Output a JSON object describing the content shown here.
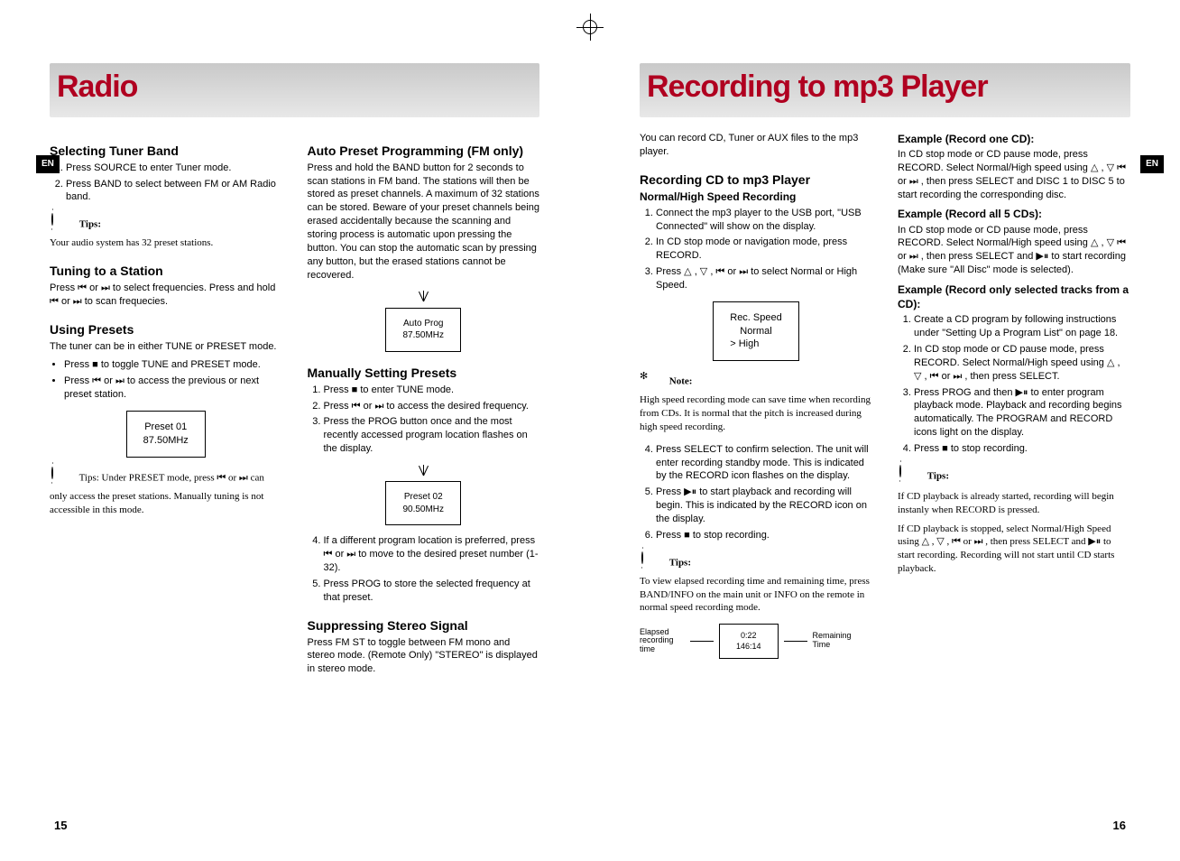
{
  "lang_badge": "EN",
  "left": {
    "chapter": "Radio",
    "page_num": "15",
    "sec_sel_band": "Selecting Tuner Band",
    "sel_band_1": "Press SOURCE to enter Tuner mode.",
    "sel_band_2": "Press BAND to select between FM or AM Radio band.",
    "tips_label": "Tips:",
    "tips_32": "Your audio system has 32 preset stations.",
    "sec_tuning": "Tuning to a Station",
    "tuning_p": "Press ⏮ or ⏭ to select frequencies. Press and hold ⏮ or ⏭ to scan frequecies.",
    "sec_presets": "Using Presets",
    "presets_intro": "The tuner can be in either TUNE or PRESET mode.",
    "presets_b1": "Press ■ to toggle TUNE and PRESET mode.",
    "presets_b2": "Press ⏮ or ⏭ to access the previous or next preset station.",
    "disp_preset01_a": "Preset 01",
    "disp_preset01_b": "87.50MHz",
    "tips_preset": "Tips: Under PRESET mode, press ⏮ or ⏭ can only access the preset stations. Manually tuning is not accessible in this mode.",
    "sec_auto": "Auto Preset Programming (FM only)",
    "auto_p": "Press and hold the BAND button for 2 seconds to scan stations in FM band. The stations will then be stored as preset channels. A maximum of 32 stations can be stored. Beware of your preset channels being erased accidentally because the scanning and storing process is automatic upon pressing the button. You can stop the automatic scan by pressing any button, but the erased stations cannot be recovered.",
    "diag_auto_a": "Auto Prog",
    "diag_auto_b": "87.50MHz",
    "sec_manual": "Manually Setting Presets",
    "man_1": "Press ■ to enter TUNE mode.",
    "man_2": "Press ⏮ or ⏭ to access the desired frequency.",
    "man_3": "Press the PROG button once and the most recently accessed program location flashes on the display.",
    "diag_man_a": "Preset 02",
    "diag_man_b": "90.50MHz",
    "man_4": "If a different program location is preferred, press ⏮ or ⏭ to move to the desired preset number (1-32).",
    "man_5": "Press PROG to store the selected frequency at that preset.",
    "sec_suppress": "Suppressing Stereo Signal",
    "suppress_p": "Press FM ST to toggle between FM mono and stereo mode. (Remote Only) \"STEREO\" is displayed in stereo mode."
  },
  "right": {
    "chapter": "Recording to mp3 Player",
    "page_num": "16",
    "intro": "You can record CD, Tuner or AUX files to the mp3 player.",
    "sec_rec_cd": "Recording CD to mp3 Player",
    "sub_norm": "Normal/High Speed Recording",
    "rec_1": "Connect the mp3 player to the USB port, \"USB Connected\" will show on the display.",
    "rec_2": "In CD stop mode or navigation mode, press RECORD.",
    "rec_3": "Press △ , ▽ , ⏮ or ⏭ to select Normal or High Speed.",
    "disp_rec_a": "Rec. Speed",
    "disp_rec_b": "Normal",
    "disp_rec_c": "> High",
    "note_label": "Note:",
    "note_hs": "High speed recording mode can save time when recording from CDs. It is normal that the pitch is increased during high speed recording.",
    "rec_4": "Press SELECT to confirm selection. The unit will enter recording standby mode. This is indicated by the RECORD icon flashes on the display.",
    "rec_5": "Press ▶⏸ to start playback and recording will begin. This is indicated by the RECORD icon on the display.",
    "rec_6": "Press ■ to stop recording.",
    "tips_view": "To view elapsed recording time and remaining time, press BAND/INFO on the main unit or INFO on the remote in normal speed recording mode.",
    "elapsed_lbl": "Elapsed recording time",
    "elapsed_a": "0:22",
    "elapsed_b": "146:14",
    "remaining_lbl": "Remaining Time",
    "ex_one": "Example (Record one CD):",
    "ex_one_p": "In CD stop mode or CD pause mode, press RECORD. Select Normal/High speed using △ , ▽ ⏮ or ⏭ , then press SELECT and DISC 1 to DISC 5 to start recording the corresponding disc.",
    "ex_all": "Example (Record all 5 CDs):",
    "ex_all_p": "In CD stop mode or CD pause mode, press RECORD. Select Normal/High speed using △ , ▽ ⏮ or ⏭ , then press SELECT and ▶⏸ to start recording (Make sure \"All Disc\" mode is selected).",
    "ex_sel": "Example (Record only selected tracks from a CD):",
    "ex_sel_1": "Create a CD program by following instructions under \"Setting Up a Program List\" on page 18.",
    "ex_sel_2": "In CD stop mode or CD pause mode, press RECORD. Select Normal/High speed using △ , ▽ , ⏮ or ⏭ , then press SELECT.",
    "ex_sel_3": "Press PROG and then ▶⏸ to enter program playback mode. Playback and recording begins automatically. The PROGRAM and RECORD icons light on the display.",
    "ex_sel_4": "Press ■ to stop recording.",
    "tips_cd_a": "If CD playback is already started, recording will begin instanly when RECORD is pressed.",
    "tips_cd_b": "If CD playback is stopped, select Normal/High Speed using △ , ▽ , ⏮ or ⏭ , then press SELECT and ▶⏸ to start recording. Recording will not start until CD starts playback.",
    "tips_label": "Tips:"
  }
}
